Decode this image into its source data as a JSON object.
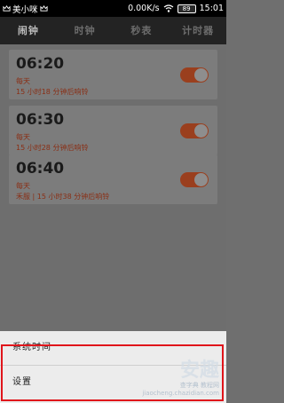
{
  "status_bar": {
    "carrier": "美小咪",
    "speed": "0.00K/s",
    "battery": "89",
    "time": "15:01"
  },
  "tabs": [
    {
      "label": "闹钟",
      "active": true
    },
    {
      "label": "时钟",
      "active": false
    },
    {
      "label": "秒表",
      "active": false
    },
    {
      "label": "计时器",
      "active": false
    }
  ],
  "alarms": [
    {
      "time": "06:20",
      "repeat": "每天",
      "next": "15 小时18 分钟后响铃",
      "enabled": true
    },
    {
      "time": "06:30",
      "repeat": "每天",
      "next": "15 小时28 分钟后响铃",
      "enabled": true
    },
    {
      "time": "06:40",
      "repeat": "每天",
      "next": "禾服 | 15 小时38 分钟后响铃",
      "enabled": true
    }
  ],
  "menu": {
    "items": [
      "系统时间",
      "设置"
    ]
  },
  "watermark": {
    "big": "安趣",
    "mid": "查字典 教程网",
    "url": "jiaocheng.chazidian.com"
  },
  "colors": {
    "accent": "#e0151b",
    "toggle_on": "#9a3f1e"
  }
}
